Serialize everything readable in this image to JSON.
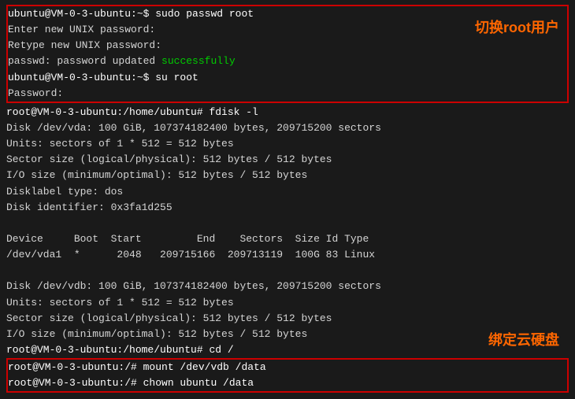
{
  "terminal": {
    "bg_color": "#1a1a1a",
    "text_color": "#d4d4d4",
    "green_color": "#00cc00",
    "red_border_color": "#cc0000",
    "annotation_color": "#ff6600"
  },
  "annotations": {
    "switch_root": "切换root用户",
    "bind_disk": "绑定云硬盘"
  },
  "lines": {
    "block1": [
      "ubuntu@VM-0-3-ubuntu:~$ sudo passwd root",
      "Enter new UNIX password:",
      "Retype new UNIX password:",
      "passwd: password updated successfully",
      "ubuntu@VM-0-3-ubuntu:~$ su root",
      "Password:"
    ],
    "fdisk_cmd": "root@VM-0-3-ubuntu:/home/ubuntu# fdisk -l",
    "disk1_info": [
      "Disk /dev/vda: 100 GiB, 107374182400 bytes, 209715200 sectors",
      "Units: sectors of 1 * 512 = 512 bytes",
      "Sector size (logical/physical): 512 bytes / 512 bytes",
      "I/O size (minimum/optimal): 512 bytes / 512 bytes",
      "Disklabel type: dos",
      "Disk identifier: 0x3fa1d255"
    ],
    "table_header": "Device     Boot Start          End    Sectors  Size Id Type",
    "table_row": "/dev/vda1  *     2048   209715166  209713119  100G 83 Linux",
    "disk2_info": [
      "Disk /dev/vdb: 100 GiB, 107374182400 bytes, 209715200 sectors",
      "Units: sectors of 1 * 512 = 512 bytes",
      "Sector size (logical/physical): 512 bytes / 512 bytes",
      "I/O size (minimum/optimal): 512 bytes / 512 bytes",
      "root@VM-0-3-ubuntu:/home/ubuntu# cd /"
    ],
    "block2": [
      "root@VM-0-3-ubuntu:/# mount /dev/vdb /data",
      "root@VM-0-3-ubuntu:/# chown ubuntu /data"
    ]
  }
}
